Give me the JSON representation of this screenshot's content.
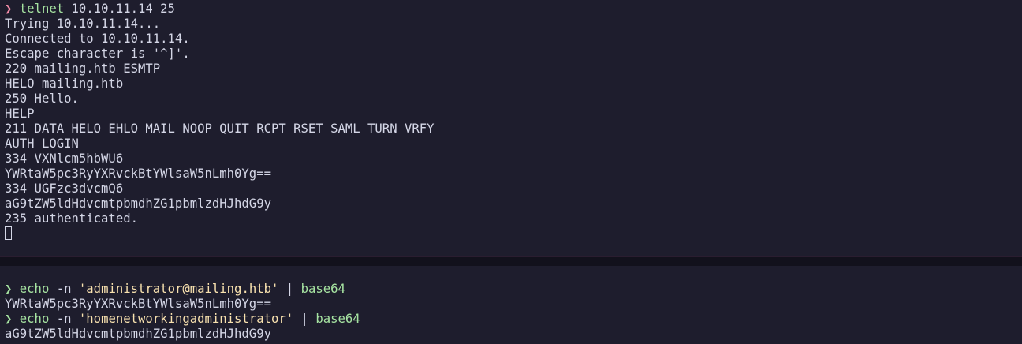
{
  "top_pane": {
    "prompt_symbol": "❯",
    "command": "telnet",
    "command_args": " 10.10.11.14 25",
    "output": [
      "Trying 10.10.11.14...",
      "Connected to 10.10.11.14.",
      "Escape character is '^]'.",
      "220 mailing.htb ESMTP",
      "HELO mailing.htb",
      "250 Hello.",
      "HELP",
      "211 DATA HELO EHLO MAIL NOOP QUIT RCPT RSET SAML TURN VRFY",
      "AUTH LOGIN",
      "334 VXNlcm5hbWU6",
      "YWRtaW5pc3RyYXRvckBtYWlsaW5nLmh0Yg==",
      "334 UGFzc3dvcmQ6",
      "aG9tZW5ldHdvcmtpbmdhZG1pbmlzdHJhdG9y",
      "235 authenticated."
    ]
  },
  "bottom_pane": {
    "commands": [
      {
        "prompt_symbol": "❯",
        "command": "echo",
        "flag": " -n ",
        "string_arg": "'administrator@mailing.htb'",
        "pipe": " | ",
        "pipe_command": "base64",
        "output": "YWRtaW5pc3RyYXRvckBtYWlsaW5nLmh0Yg=="
      },
      {
        "prompt_symbol": "❯",
        "command": "echo",
        "flag": " -n ",
        "string_arg": "'homenetworkingadministrator'",
        "pipe": " | ",
        "pipe_command": "base64",
        "output": "aG9tZW5ldHdvcmtpbmdhZG1pbmlzdHJhdG9y"
      }
    ]
  },
  "colors": {
    "background": "#1e1d2d",
    "text": "#d4d6e6",
    "prompt_error": "#f38ba8",
    "prompt_ok": "#a6e3a1",
    "command": "#a6e3a1",
    "string": "#f9e2af",
    "divider": "#12111c"
  }
}
